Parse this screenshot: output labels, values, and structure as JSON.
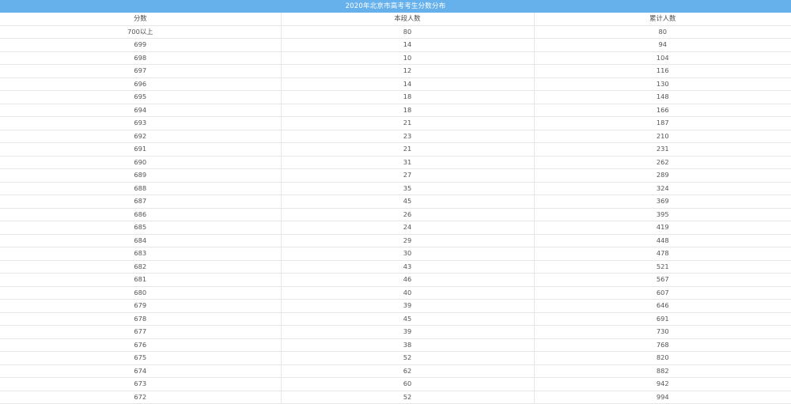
{
  "title": "2020年北京市高考考生分数分布",
  "columns": [
    "分数",
    "本段人数",
    "累计人数"
  ],
  "rows": [
    [
      "700以上",
      "80",
      "80"
    ],
    [
      "699",
      "14",
      "94"
    ],
    [
      "698",
      "10",
      "104"
    ],
    [
      "697",
      "12",
      "116"
    ],
    [
      "696",
      "14",
      "130"
    ],
    [
      "695",
      "18",
      "148"
    ],
    [
      "694",
      "18",
      "166"
    ],
    [
      "693",
      "21",
      "187"
    ],
    [
      "692",
      "23",
      "210"
    ],
    [
      "691",
      "21",
      "231"
    ],
    [
      "690",
      "31",
      "262"
    ],
    [
      "689",
      "27",
      "289"
    ],
    [
      "688",
      "35",
      "324"
    ],
    [
      "687",
      "45",
      "369"
    ],
    [
      "686",
      "26",
      "395"
    ],
    [
      "685",
      "24",
      "419"
    ],
    [
      "684",
      "29",
      "448"
    ],
    [
      "683",
      "30",
      "478"
    ],
    [
      "682",
      "43",
      "521"
    ],
    [
      "681",
      "46",
      "567"
    ],
    [
      "680",
      "40",
      "607"
    ],
    [
      "679",
      "39",
      "646"
    ],
    [
      "678",
      "45",
      "691"
    ],
    [
      "677",
      "39",
      "730"
    ],
    [
      "676",
      "38",
      "768"
    ],
    [
      "675",
      "52",
      "820"
    ],
    [
      "674",
      "62",
      "882"
    ],
    [
      "673",
      "60",
      "942"
    ],
    [
      "672",
      "52",
      "994"
    ]
  ],
  "colors": {
    "title_bar": "#66b1ec",
    "border": "#e6e6e6",
    "text": "#555555"
  }
}
